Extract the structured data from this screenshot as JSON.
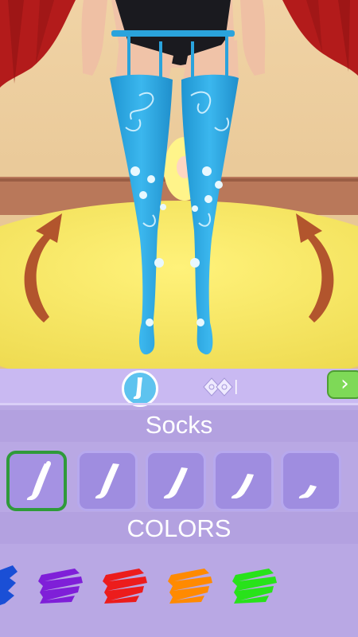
{
  "editor": {
    "category_title": "Socks",
    "colors_title": "COLORS",
    "next_symbol": "›",
    "selected_slot": 0
  },
  "tabs": [
    {
      "icon": "sock-icon",
      "active": true
    },
    {
      "icon": "lace-pattern-icon",
      "active": false
    }
  ],
  "sock_styles": [
    {
      "icon": "thigh-high-sock-icon",
      "selected": true
    },
    {
      "icon": "thigh-high-sock-icon",
      "selected": false
    },
    {
      "icon": "knee-sock-icon",
      "selected": false
    },
    {
      "icon": "calf-sock-icon",
      "selected": false
    },
    {
      "icon": "ankle-sock-icon",
      "selected": false
    }
  ],
  "color_swatches": [
    {
      "name": "blue",
      "color": "#1a4fd6"
    },
    {
      "name": "purple",
      "color": "#7f1fd8"
    },
    {
      "name": "red",
      "color": "#ec1c1c"
    },
    {
      "name": "orange",
      "color": "#ff8a00"
    },
    {
      "name": "green",
      "color": "#28e21a"
    }
  ],
  "scene_colors": {
    "sock": "#29a8e0",
    "platform": "#f4e35a",
    "curtain": "#b31b1b",
    "arrow": "#b2552d"
  }
}
